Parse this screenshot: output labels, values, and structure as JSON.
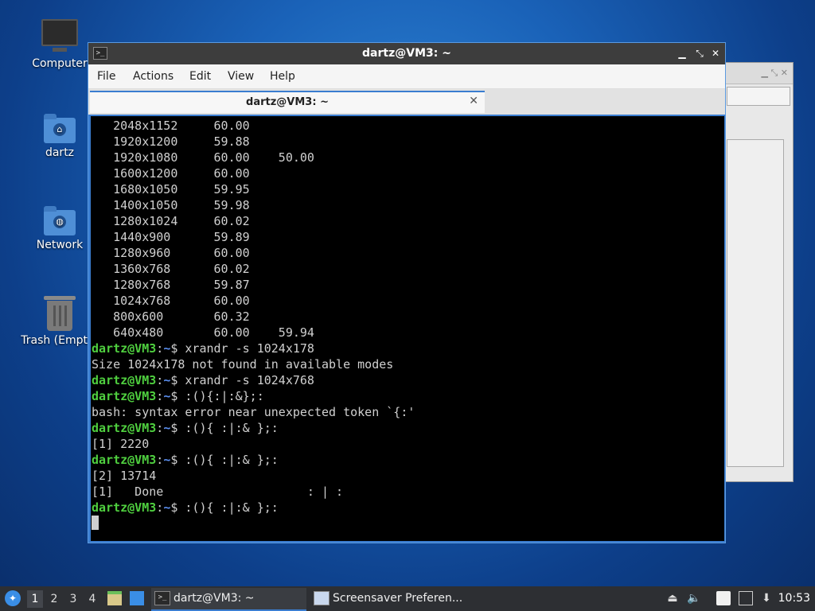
{
  "desktop": {
    "icons": [
      {
        "label": "Computer"
      },
      {
        "label": "dartz"
      },
      {
        "label": "Network"
      },
      {
        "label": "Trash (Empty)"
      }
    ]
  },
  "window": {
    "title": "dartz@VM3: ~",
    "controls": {
      "minimize": "▁",
      "maximize": "⤡",
      "close": "✕"
    }
  },
  "menubar": {
    "items": [
      "File",
      "Actions",
      "Edit",
      "View",
      "Help"
    ]
  },
  "tab": {
    "label": "dartz@VM3: ~",
    "close": "✕"
  },
  "terminal": {
    "prompt_user": "dartz@VM3",
    "prompt_sep": ":",
    "prompt_path": "~",
    "prompt_sym": "$ ",
    "modes": [
      "   2048x1152     60.00",
      "   1920x1200     59.88",
      "   1920x1080     60.00    50.00",
      "   1600x1200     60.00",
      "   1680x1050     59.95",
      "   1400x1050     59.98",
      "   1280x1024     60.02",
      "   1440x900      59.89",
      "   1280x960      60.00",
      "   1360x768      60.02",
      "   1280x768      59.87",
      "   1024x768      60.00",
      "   800x600       60.32",
      "   640x480       60.00    59.94"
    ],
    "cmd1": "xrandr -s 1024x178",
    "out1": "Size 1024x178 not found in available modes",
    "cmd2": "xrandr -s 1024x768",
    "cmd3": ":(){:|:&};:",
    "out3": "bash: syntax error near unexpected token `{:'",
    "cmd4": ":(){ :|:& };:",
    "out4": "[1] 2220",
    "cmd5": ":(){ :|:& };:",
    "out5a": "[2] 13714",
    "out5b": "[1]   Done                    : | :",
    "cmd6": ":(){ :|:& };:"
  },
  "taskbar": {
    "workspaces": [
      "1",
      "2",
      "3",
      "4"
    ],
    "tasks": [
      {
        "label": "dartz@VM3: ~",
        "active": true
      },
      {
        "label": "Screensaver Preferen...",
        "active": false
      }
    ],
    "clock": "10:53"
  },
  "colors": {
    "prompt_user": "#4fcf3f",
    "prompt_path": "#5b8ff0",
    "accent": "#3a7dd0"
  }
}
